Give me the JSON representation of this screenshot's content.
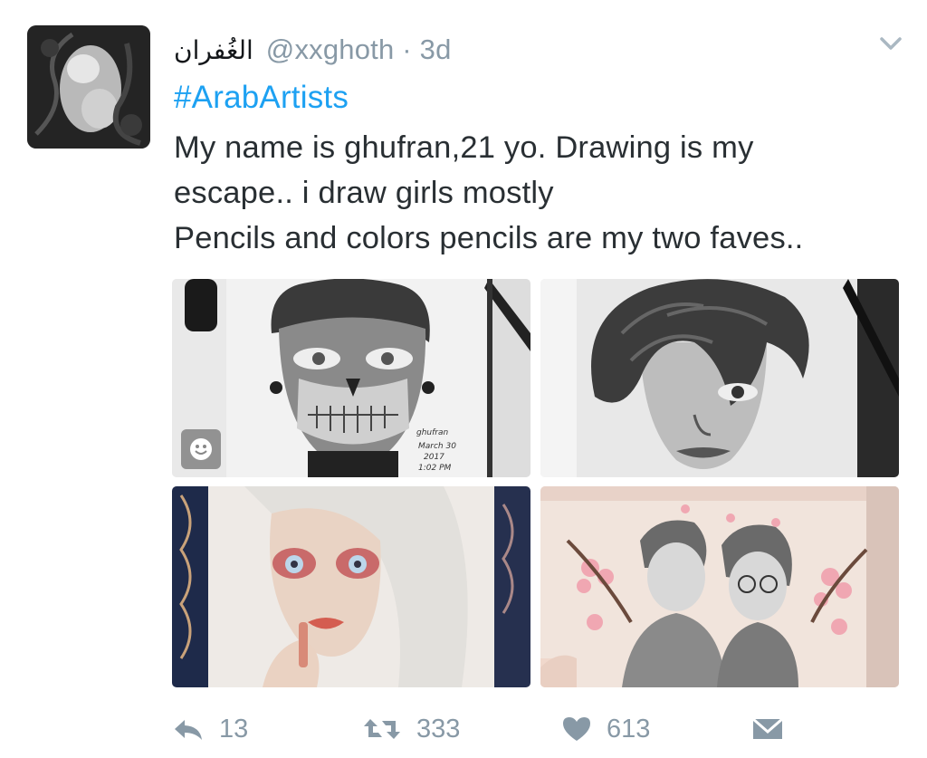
{
  "tweet": {
    "display_name": "الغُفران",
    "handle": "@xxghoth",
    "separator": "·",
    "time": "3d",
    "hashtag": "#ArabArtists",
    "text_lines": [
      "My name is ghufran,21 yo. Drawing is my",
      "escape.. i draw girls mostly",
      "Pencils and colors pencils are my two faves.."
    ],
    "media": [
      {
        "name": "sketch-skull-face",
        "signature": [
          "ghufran",
          "March 30",
          "2017",
          "1:02 PM"
        ]
      },
      {
        "name": "sketch-wavy-hair-portrait"
      },
      {
        "name": "colored-pencil-red-eyes-portrait"
      },
      {
        "name": "sketch-two-girls-cherry-blossoms"
      }
    ]
  },
  "actions": {
    "reply_count": "13",
    "retweet_count": "333",
    "like_count": "613"
  },
  "colors": {
    "hashtag": "#1da1f2",
    "muted": "#8899a6",
    "text": "#292f33"
  },
  "icons": [
    "avatar-photo",
    "chevron-down-icon",
    "sticker-icon",
    "reply-icon",
    "retweet-icon",
    "heart-icon",
    "direct-message-icon"
  ]
}
